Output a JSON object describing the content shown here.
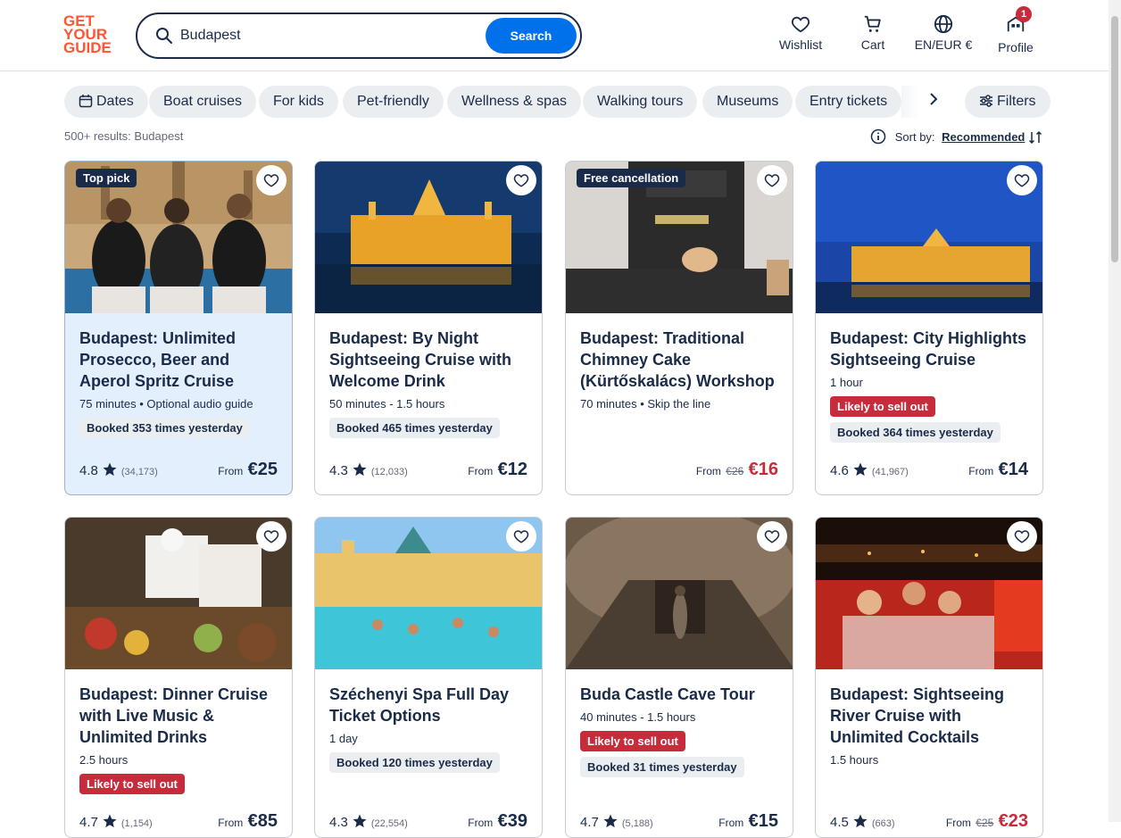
{
  "logo": {
    "line1": "GET",
    "line2": "YOUR",
    "line3": "GUIDE"
  },
  "search": {
    "value": "Budapest",
    "button": "Search"
  },
  "nav": {
    "wishlist": "Wishlist",
    "cart": "Cart",
    "language": "EN/EUR €",
    "profile": "Profile",
    "profile_badge": "1"
  },
  "filters": [
    "Dates",
    "Boat cruises",
    "For kids",
    "Pet-friendly",
    "Wellness & spas",
    "Walking tours",
    "Museums",
    "Entry tickets"
  ],
  "filters_button": "Filters",
  "results": {
    "count": "500+ results: Budapest",
    "sort_label": "Sort by:",
    "sort_value": "Recommended"
  },
  "cards": [
    {
      "tag": "Top pick",
      "title": "Budapest: Unlimited Prosecco, Beer and Aperol Spritz Cruise",
      "meta": "75 minutes • Optional audio guide",
      "sellout": "",
      "booked": "Booked 353 times yesterday",
      "rating": "4.8",
      "reviews": "(34,173)",
      "from": "From",
      "old_price": "",
      "price": "€25"
    },
    {
      "tag": "",
      "title": "Budapest: By Night Sightseeing Cruise with Welcome Drink",
      "meta": "50 minutes - 1.5 hours",
      "sellout": "",
      "booked": "Booked 465 times yesterday",
      "rating": "4.3",
      "reviews": "(12,033)",
      "from": "From",
      "old_price": "",
      "price": "€12"
    },
    {
      "tag": "Free cancellation",
      "title": "Budapest: Traditional Chimney Cake (Kürtőskalács) Workshop",
      "meta": "70 minutes • Skip the line",
      "sellout": "",
      "booked": "",
      "rating": "",
      "reviews": "",
      "from": "From",
      "old_price": "€26",
      "price": "€16"
    },
    {
      "tag": "",
      "title": "Budapest: City Highlights Sightseeing Cruise",
      "meta": "1 hour",
      "sellout": "Likely to sell out",
      "booked": "Booked 364 times yesterday",
      "rating": "4.6",
      "reviews": "(41,967)",
      "from": "From",
      "old_price": "",
      "price": "€14"
    },
    {
      "tag": "",
      "title": "Budapest: Dinner Cruise with Live Music & Unlimited Drinks",
      "meta": "2.5 hours",
      "sellout": "Likely to sell out",
      "booked": "",
      "rating": "4.7",
      "reviews": "(1,154)",
      "from": "From",
      "old_price": "",
      "price": "€85"
    },
    {
      "tag": "",
      "title": "Széchenyi Spa Full Day Ticket Options",
      "meta": "1 day",
      "sellout": "",
      "booked": "Booked 120 times yesterday",
      "rating": "4.3",
      "reviews": "(22,554)",
      "from": "From",
      "old_price": "",
      "price": "€39"
    },
    {
      "tag": "",
      "title": "Buda Castle Cave Tour",
      "meta": "40 minutes - 1.5 hours",
      "sellout": "Likely to sell out",
      "booked": "Booked 31 times yesterday",
      "rating": "4.7",
      "reviews": "(5,188)",
      "from": "From",
      "old_price": "",
      "price": "€15"
    },
    {
      "tag": "",
      "title": "Budapest: Sightseeing River Cruise with Unlimited Cocktails",
      "meta": "1.5 hours",
      "sellout": "",
      "booked": "",
      "rating": "4.5",
      "reviews": "(663)",
      "from": "From",
      "old_price": "€25",
      "price": "€23"
    }
  ],
  "colors": {
    "brand": "#ff5533",
    "accent": "#0071eb",
    "ink": "#1a2b49",
    "sale": "#c72c3c"
  }
}
